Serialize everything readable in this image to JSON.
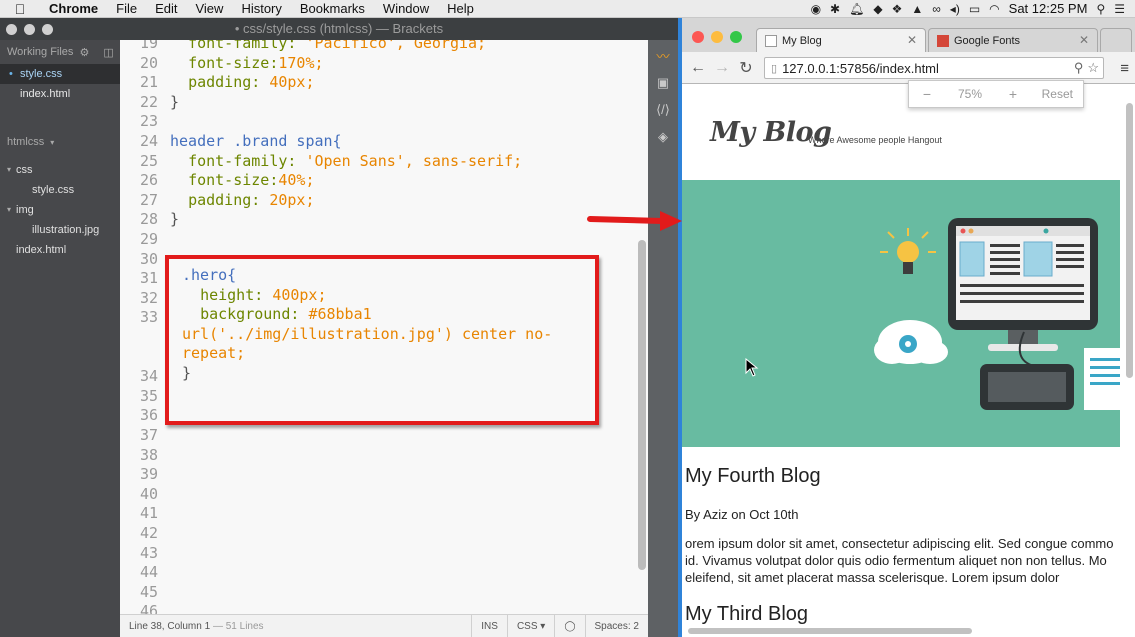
{
  "menubar": {
    "app_name": "Chrome",
    "menus": [
      "File",
      "Edit",
      "View",
      "History",
      "Bookmarks",
      "Window",
      "Help"
    ],
    "clock": "Sat 12:25 PM"
  },
  "brackets": {
    "window_title": "• css/style.css (htmlcss) — Brackets",
    "working_files_label": "Working Files",
    "working_files": [
      "style.css",
      "index.html"
    ],
    "project_label": "htmlcss",
    "tree": {
      "css_folder": "css",
      "css_file": "style.css",
      "img_folder": "img",
      "img_file": "illustration.jpg",
      "root_file": "index.html"
    },
    "code": {
      "l19_num": "19",
      "l19_prop": "font-family:",
      "l19_val": "'Pacifico', Georgia;",
      "l20_num": "20",
      "l20_prop": "font-size:",
      "l20_val": "170%;",
      "l21_num": "21",
      "l21_prop": "padding:",
      "l21_val": "40px;",
      "l22_num": "22",
      "l22_txt": "}",
      "l23_num": "23",
      "l24_num": "24",
      "l24_sel": "header .brand span{",
      "l25_num": "25",
      "l25_prop": "font-family:",
      "l25_val": "'Open Sans', sans-serif;",
      "l26_num": "26",
      "l26_prop": "font-size:",
      "l26_val": "40%;",
      "l27_num": "27",
      "l27_prop": "padding:",
      "l27_val": "20px;",
      "l28_num": "28",
      "l28_txt": "}",
      "l29_num": "29",
      "l30_num": "30",
      "l31_num": "31",
      "l32_num": "32",
      "l33_num": "33",
      "l34_num": "34",
      "l35_num": "35",
      "l36_num": "36",
      "l37_num": "37",
      "l38_num": "38",
      "l39_num": "39",
      "l40_num": "40",
      "l41_num": "41",
      "l42_num": "42",
      "l43_num": "43",
      "l44_num": "44",
      "l45_num": "45",
      "l46_num": "46",
      "hero_sel": ".hero{",
      "hero_h_prop": "height:",
      "hero_h_val": "400px;",
      "hero_bg_prop": "background:",
      "hero_bg_val": "#68bba1",
      "hero_url": "url('../img/illustration.jpg')",
      "hero_pos": "center no-",
      "hero_repeat": "repeat;",
      "hero_close": "}"
    },
    "status": {
      "cursor": "Line 38, Column 1",
      "lines": "— 51 Lines",
      "mode": "INS",
      "language": "CSS",
      "spaces": "Spaces: 2"
    }
  },
  "chrome": {
    "tabs": [
      {
        "title": "My Blog"
      },
      {
        "title": "Google Fonts"
      }
    ],
    "url": "127.0.0.1:57856/index.html",
    "zoom": {
      "minus": "−",
      "value": "75%",
      "plus": "+",
      "reset": "Reset"
    }
  },
  "blog": {
    "brand": "My Blog",
    "tagline": "Where Awesome people Hangout",
    "posts": [
      {
        "title": "My Fourth Blog",
        "meta": "By Aziz on Oct 10th",
        "body_1": "orem ipsum dolor sit amet, consectetur adipiscing elit. Sed congue commo",
        "body_2": "id. Vivamus volutpat dolor quis odio fermentum aliquet non non tellus. Mo",
        "body_3": "eleifend, sit amet placerat massa scelerisque. Lorem ipsum dolor"
      },
      {
        "title": "My Third Blog"
      }
    ]
  },
  "colors": {
    "hero_bg": "#68bba1",
    "highlight_box": "#e21b1b",
    "chrome_focus": "#2f83d9"
  }
}
